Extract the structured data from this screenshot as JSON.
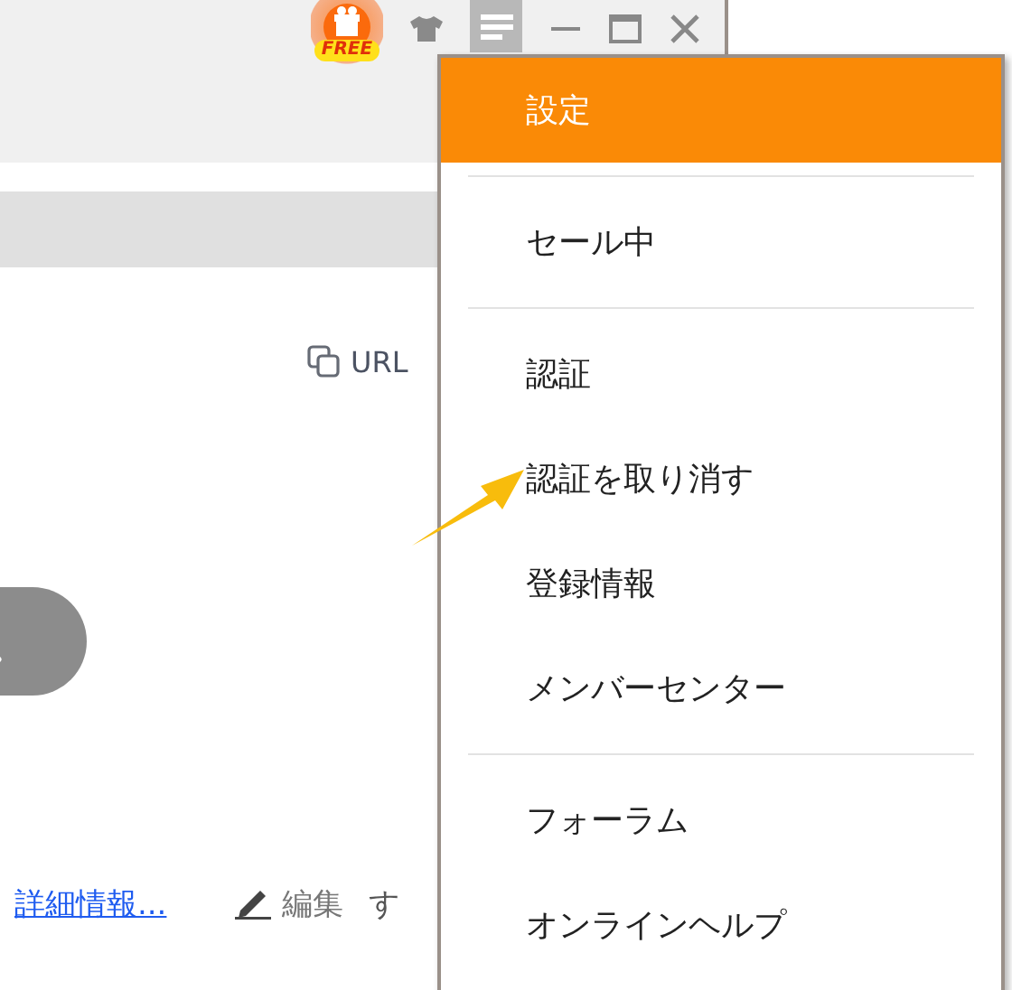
{
  "toolbar": {
    "badge": "FREE"
  },
  "content": {
    "copy_url": "URL",
    "links": [
      {
        "kind": "link",
        "text": "詳細情報..."
      },
      {
        "kind": "edit",
        "text": "編集"
      },
      {
        "kind": "plain",
        "text": "す"
      }
    ]
  },
  "menu": {
    "groups": [
      {
        "items": [
          {
            "label": "設定",
            "selected": true
          }
        ]
      },
      {
        "items": [
          {
            "label": "セール中",
            "selected": false
          }
        ]
      },
      {
        "items": [
          {
            "label": "認証",
            "selected": false
          },
          {
            "label": "認証を取り消す",
            "selected": false
          },
          {
            "label": "登録情報",
            "selected": false
          },
          {
            "label": "メンバーセンター",
            "selected": false
          }
        ]
      },
      {
        "items": [
          {
            "label": "フォーラム",
            "selected": false
          },
          {
            "label": "オンラインヘルプ",
            "selected": false
          }
        ]
      }
    ]
  }
}
